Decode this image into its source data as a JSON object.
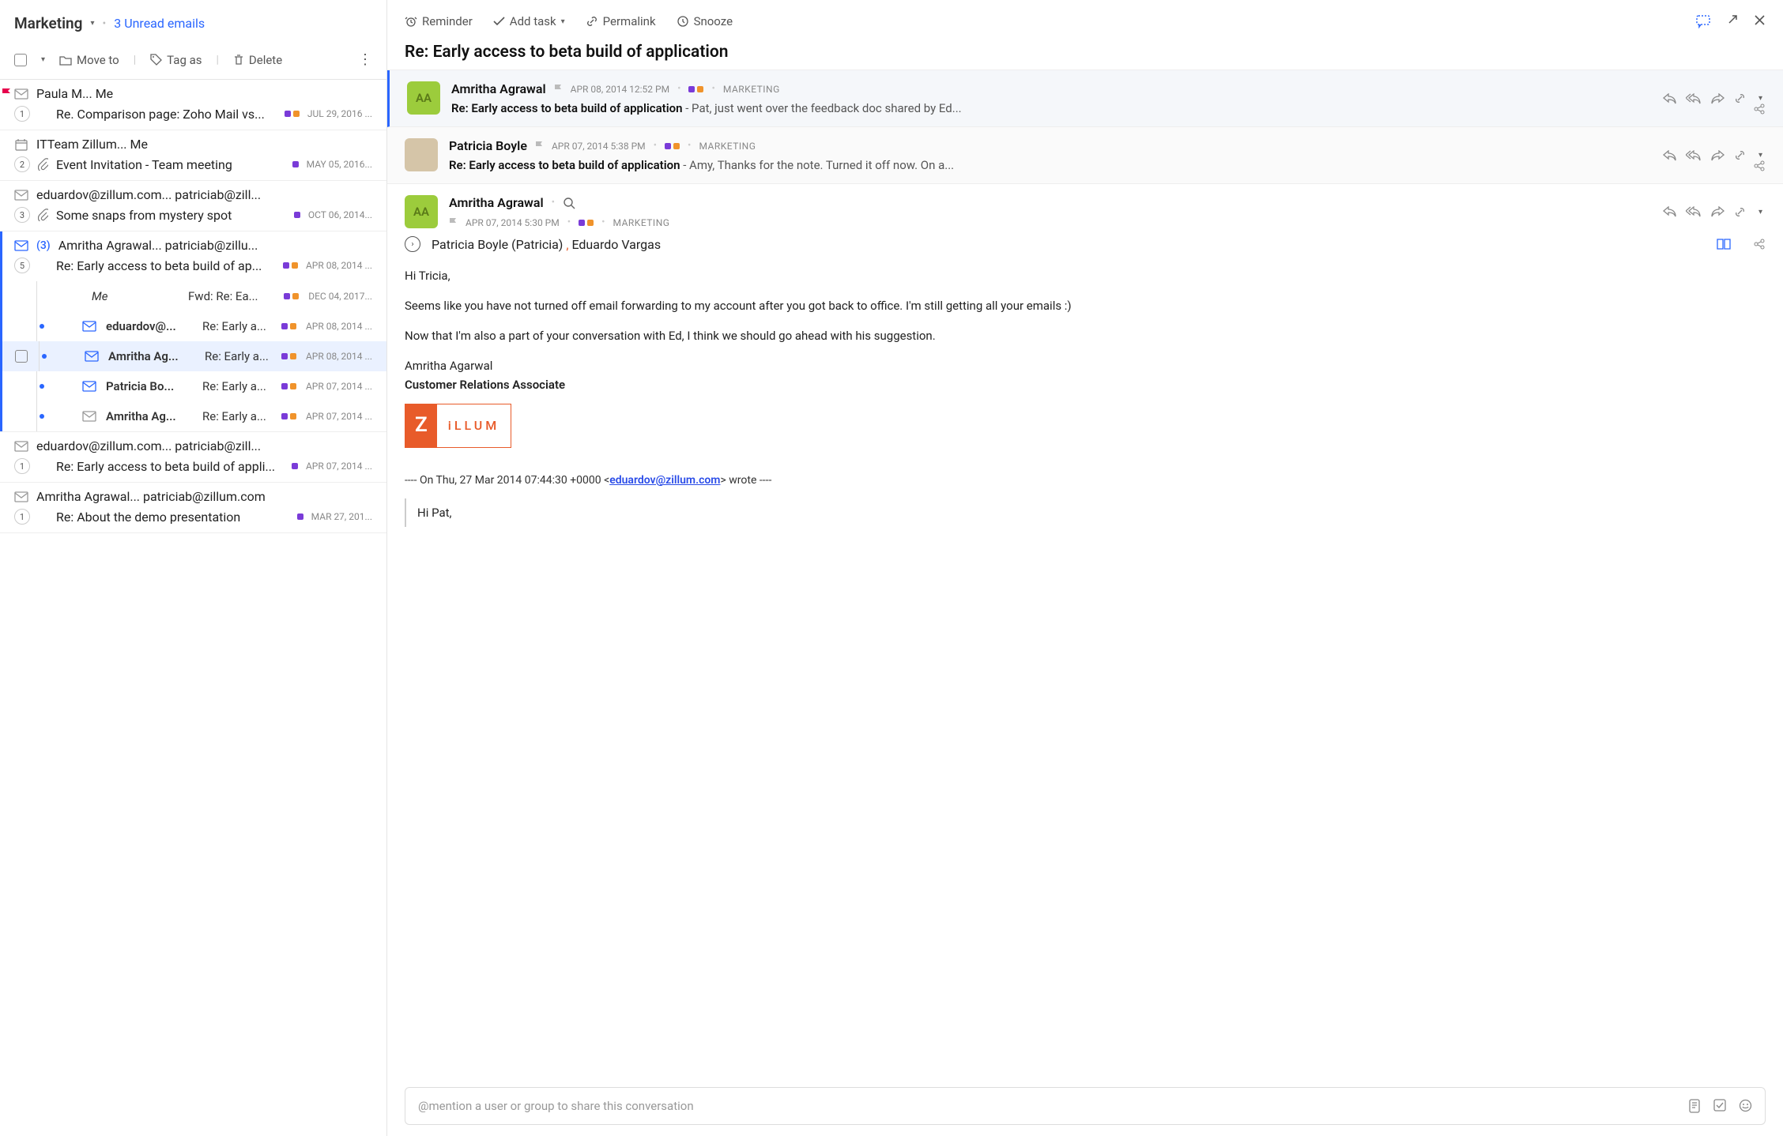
{
  "folder": {
    "name": "Marketing",
    "unread_text": "3 Unread emails"
  },
  "toolbar": {
    "move": "Move to",
    "tag": "Tag as",
    "delete": "Delete"
  },
  "threads": [
    {
      "senders": "Paula M... Me",
      "count": "1",
      "flagged": true,
      "subject": "Re. Comparison page: Zoho Mail vs...",
      "date": "JUL 29, 2016 ...",
      "tags": [
        "#7a3bd8",
        "#f0932b"
      ]
    },
    {
      "senders": "ITTeam Zillum... Me",
      "count": "2",
      "calendar": true,
      "attach": true,
      "subject": "Event Invitation - Team meeting",
      "date": "MAY 05, 2016...",
      "tags": [
        "#7a3bd8"
      ]
    },
    {
      "senders": "eduardov@zillum.com... patriciab@zill...",
      "count": "3",
      "attach": true,
      "subject": "Some snaps from mystery spot",
      "date": "OCT 06, 2014...",
      "tags": [
        "#7a3bd8"
      ]
    },
    {
      "active": true,
      "blue_env": true,
      "senders": "Amritha Agrawal... patriciab@zillu...",
      "inner_count": "(3)",
      "count": "5",
      "subject": "Re: Early access to beta build of ap...",
      "date": "APR 08, 2014 ...",
      "tags": [
        "#7a3bd8",
        "#f0932b"
      ],
      "children": [
        {
          "from": "Me",
          "subj": "Fwd: Re: Ea...",
          "date": "DEC 04, 2017...",
          "tags": [
            "#7a3bd8",
            "#f0932b"
          ],
          "icon": "none"
        },
        {
          "from": "eduardov@...",
          "subj": "Re: Early a...",
          "date": "APR 08, 2014 ...",
          "tags": [
            "#7a3bd8",
            "#f0932b"
          ],
          "icon": "blue",
          "bullet": true
        },
        {
          "from": "Amritha Ag...",
          "subj": "Re: Early a...",
          "date": "APR 08, 2014 ...",
          "tags": [
            "#7a3bd8",
            "#f0932b"
          ],
          "icon": "blue",
          "bullet": true,
          "selected": true
        },
        {
          "from": "Patricia Bo...",
          "subj": "Re: Early a...",
          "date": "APR 07, 2014 ...",
          "tags": [
            "#7a3bd8",
            "#f0932b"
          ],
          "icon": "blue",
          "bullet": true
        },
        {
          "from": "Amritha Ag...",
          "subj": "Re: Early a...",
          "date": "APR 07, 2014 ...",
          "tags": [
            "#7a3bd8",
            "#f0932b"
          ],
          "icon": "grey",
          "bullet": true
        }
      ]
    },
    {
      "senders": "eduardov@zillum.com... patriciab@zill...",
      "count": "1",
      "subject": "Re: Early access to beta build of appli...",
      "date": "APR 07, 2014 ...",
      "tags": [
        "#7a3bd8"
      ]
    },
    {
      "senders": "Amritha Agrawal... patriciab@zillum.com",
      "count": "1",
      "subject": "Re: About the demo presentation",
      "date": "MAR 27, 201...",
      "tags": [
        "#7a3bd8"
      ]
    }
  ],
  "rp": {
    "actions": {
      "reminder": "Reminder",
      "addtask": "Add task",
      "permalink": "Permalink",
      "snooze": "Snooze"
    },
    "subject": "Re: Early access to beta build of application",
    "messages": [
      {
        "from": "Amritha Agrawal",
        "avatar": "AA",
        "avatar_class": "green",
        "date": "APR 08, 2014 12:52 PM",
        "label": "MARKETING",
        "subject": "Re: Early access to beta build of application",
        "preview": "- Pat, just went over the feedback doc shared by Ed...",
        "tags": [
          "#7a3bd8",
          "#f0932b"
        ],
        "selected": true
      },
      {
        "from": "Patricia Boyle",
        "avatar": "",
        "avatar_class": "photo",
        "date": "APR 07, 2014 5:38 PM",
        "label": "MARKETING",
        "subject": "Re: Early access to beta build of application",
        "preview": "- Amy, Thanks for the note. Turned it off now. On a...",
        "tags": [
          "#7a3bd8",
          "#f0932b"
        ]
      }
    ],
    "expanded": {
      "from": "Amritha Agrawal",
      "avatar": "AA",
      "date": "APR 07, 2014 5:30 PM",
      "label": "MARKETING",
      "tags": [
        "#7a3bd8",
        "#f0932b"
      ],
      "recipients_a": "Patricia Boyle (Patricia)",
      "recipients_b": "Eduardo Vargas",
      "greeting": "Hi Tricia,",
      "para1": "Seems like you have not turned off email forwarding to my account after you got back to office. I'm still getting all your emails :)",
      "para2": "Now that I'm also a part of your conversation with Ed, I think we should go ahead with his suggestion.",
      "sig_name": "Amritha Agarwal",
      "sig_title": "Customer Relations Associate",
      "logo_text": "iLLUM",
      "quote_prefix_a": "---- On Thu, 27 Mar 2014 07:44:30 +0000 <",
      "quote_email": "eduardov@zillum.com",
      "quote_prefix_b": "> wrote ----",
      "quote_body": "Hi Pat,"
    },
    "mention_placeholder": "@mention a user or group to share this conversation"
  }
}
